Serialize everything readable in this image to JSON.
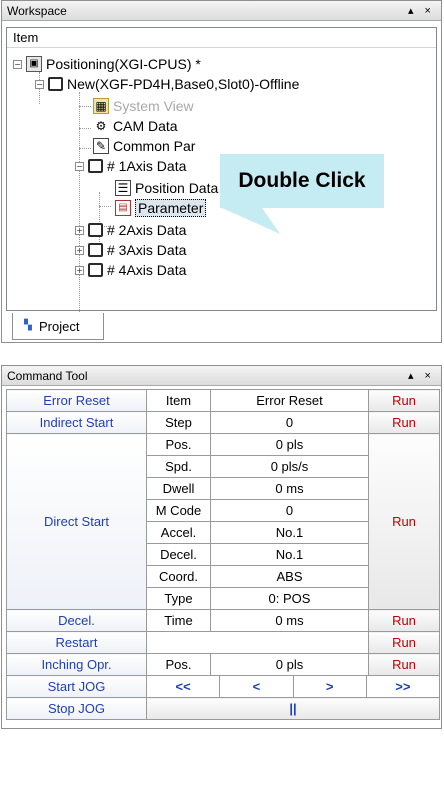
{
  "workspace": {
    "title": "Workspace",
    "controls": "▴ ×",
    "tree_header": "Item",
    "nodes": {
      "root": "Positioning(XGI-CPUS) *",
      "module": "New(XGF-PD4H,Base0,Slot0)-Offline",
      "system_view": "System View",
      "cam_data": "CAM Data",
      "common_param": "Common Par",
      "axis1": "# 1Axis Data",
      "position_data": "Position Data",
      "parameter": "Parameter",
      "axis2": "# 2Axis Data",
      "axis3": "# 3Axis Data",
      "axis4": "# 4Axis Data"
    },
    "callout": "Double Click",
    "tab_label": "Project"
  },
  "command_tool": {
    "title": "Command Tool",
    "controls": "▴ ×",
    "rows": {
      "error_reset": {
        "name": "Error Reset",
        "item": "Item",
        "value": "Error Reset",
        "run": "Run"
      },
      "indirect_start": {
        "name": "Indirect Start",
        "item": "Step",
        "value": "0",
        "run": "Run"
      },
      "direct_start": {
        "name": "Direct Start",
        "run": "Run",
        "params": [
          {
            "item": "Pos.",
            "value": "0 pls"
          },
          {
            "item": "Spd.",
            "value": "0 pls/s"
          },
          {
            "item": "Dwell",
            "value": "0 ms"
          },
          {
            "item": "M Code",
            "value": "0"
          },
          {
            "item": "Accel.",
            "value": "No.1"
          },
          {
            "item": "Decel.",
            "value": "No.1"
          },
          {
            "item": "Coord.",
            "value": "ABS"
          },
          {
            "item": "Type",
            "value": "0: POS"
          }
        ]
      },
      "decel": {
        "name": "Decel.",
        "item": "Time",
        "value": "0 ms",
        "run": "Run"
      },
      "restart": {
        "name": "Restart",
        "run": "Run"
      },
      "inching": {
        "name": "Inching Opr.",
        "item": "Pos.",
        "value": "0 pls",
        "run": "Run"
      },
      "start_jog": {
        "name": "Start JOG",
        "buttons": [
          "<<",
          "<",
          ">",
          ">>"
        ]
      },
      "stop_jog": {
        "name": "Stop JOG",
        "button": "||"
      }
    }
  }
}
